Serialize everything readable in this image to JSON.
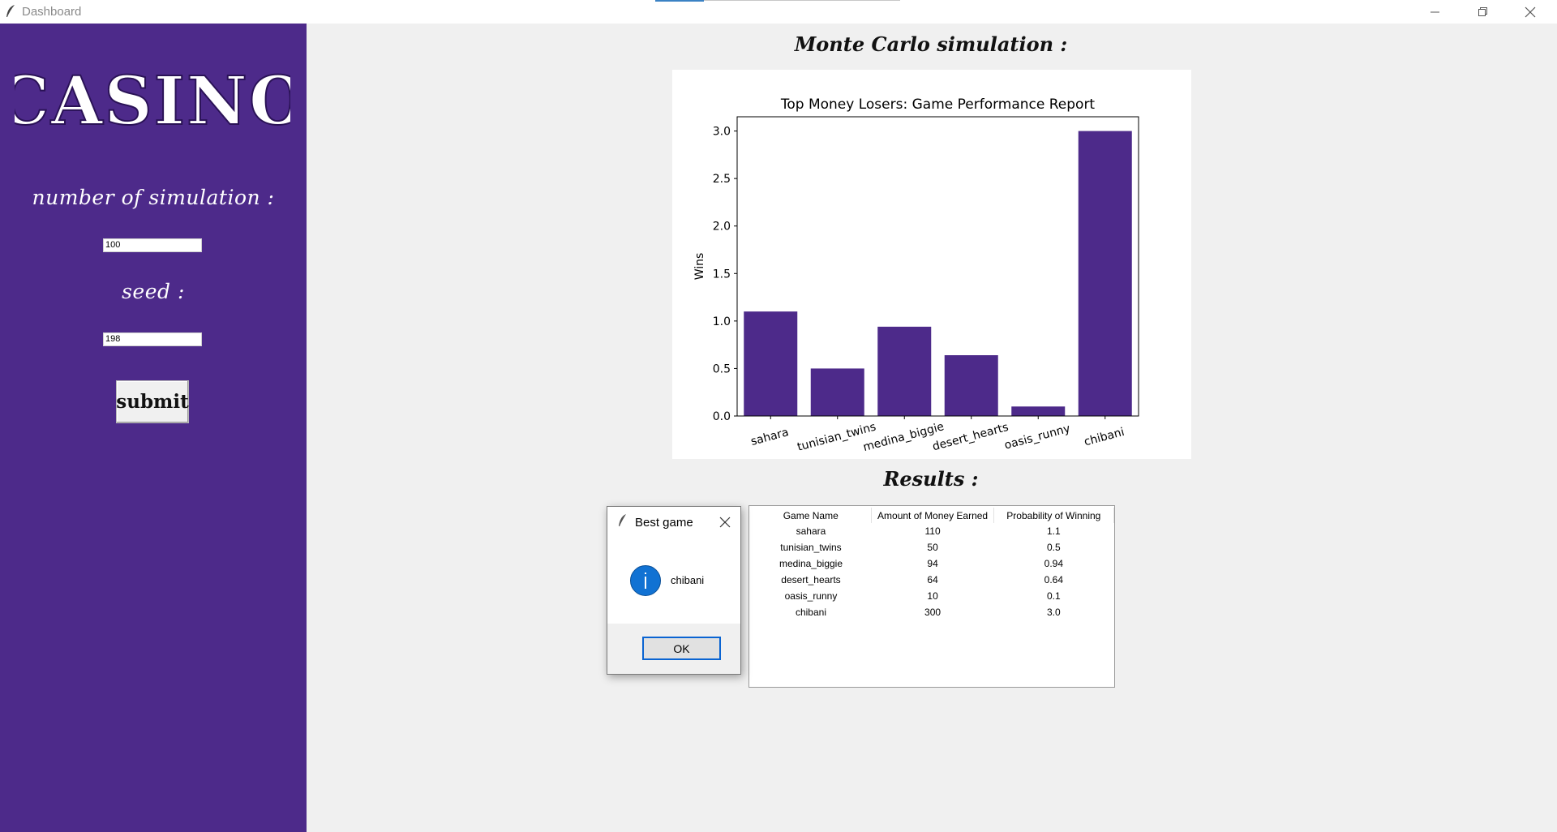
{
  "window": {
    "title": "Dashboard"
  },
  "sidebar": {
    "logo_text": "CASINO",
    "simulations_label": "number of simulation :",
    "simulations_value": "100",
    "seed_label": "seed :",
    "seed_value": "198",
    "submit_label": "submit"
  },
  "main": {
    "heading": "Monte Carlo simulation :",
    "results_heading": "Results :"
  },
  "chart_data": {
    "type": "bar",
    "title": "Top Money Losers: Game Performance Report",
    "xlabel": "",
    "ylabel": "Wins",
    "categories": [
      "sahara",
      "tunisian_twins",
      "medina_biggie",
      "desert_hearts",
      "oasis_runny",
      "chibani"
    ],
    "values": [
      1.1,
      0.5,
      0.94,
      0.64,
      0.1,
      3.0
    ],
    "ylim": [
      0,
      3.15
    ],
    "yticks": [
      "0.0",
      "0.5",
      "1.0",
      "1.5",
      "2.0",
      "2.5",
      "3.0"
    ],
    "grid": false,
    "bar_color": "#4d2a8a"
  },
  "results": {
    "headers": [
      "Game Name",
      "Amount of Money Earned",
      "Probability of Winning"
    ],
    "rows": [
      [
        "sahara",
        "110",
        "1.1"
      ],
      [
        "tunisian_twins",
        "50",
        "0.5"
      ],
      [
        "medina_biggie",
        "94",
        "0.94"
      ],
      [
        "desert_hearts",
        "64",
        "0.64"
      ],
      [
        "oasis_runny",
        "10",
        "0.1"
      ],
      [
        "chibani",
        "300",
        "3.0"
      ]
    ]
  },
  "dialog": {
    "title": "Best game",
    "message": "chibani",
    "ok_label": "OK",
    "icon": "info-icon"
  },
  "colors": {
    "sidebar_bg": "#4d2a8a",
    "bar": "#4d2a8a",
    "dialog_button_border": "#0a64d2",
    "info_icon": "#1172d3"
  }
}
